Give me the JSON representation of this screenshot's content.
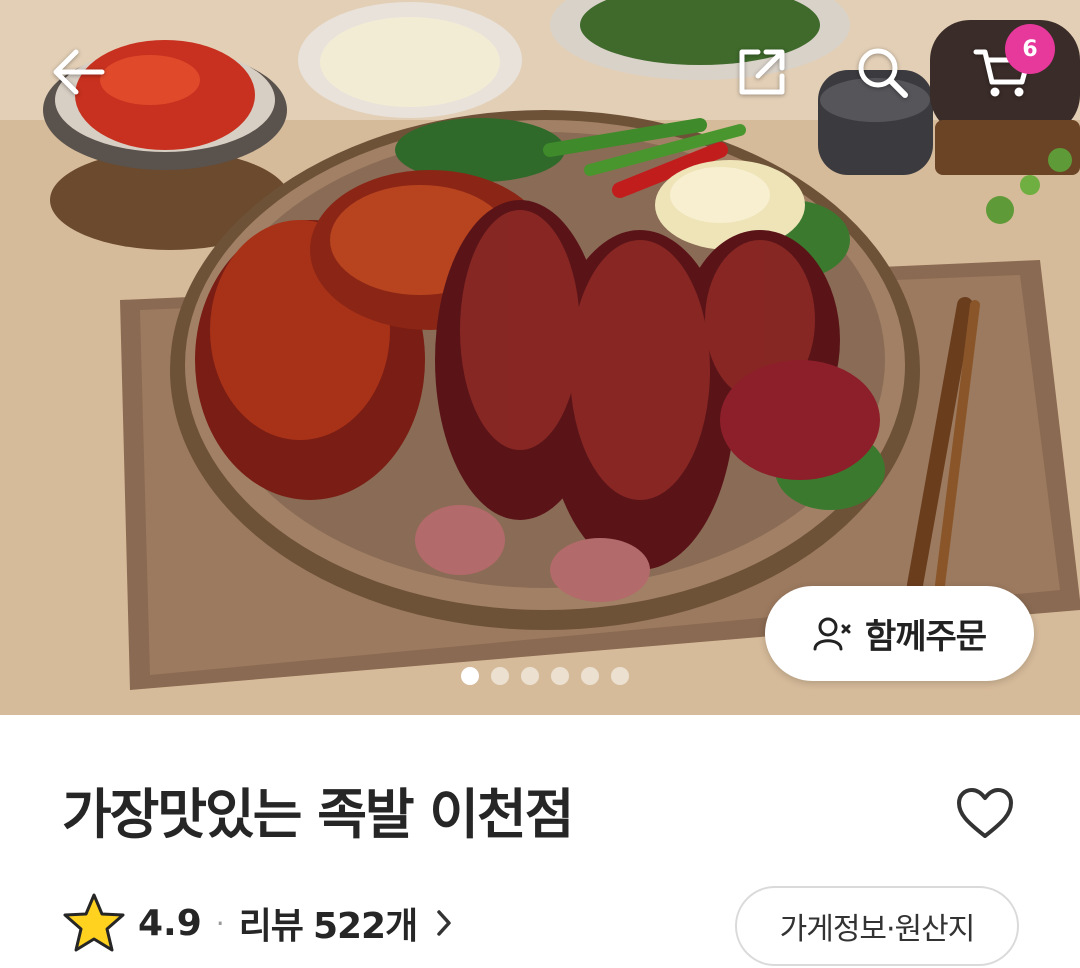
{
  "header": {
    "back_icon": "arrow-left-icon",
    "share_icon": "share-icon",
    "search_icon": "search-icon",
    "cart_icon": "cart-icon",
    "cart_count": "6"
  },
  "hero": {
    "group_order_label": "함께주문",
    "group_order_icon": "person-add-icon",
    "carousel_total": 6,
    "carousel_active": 1
  },
  "store": {
    "name": "가장맛있는 족발 이천점",
    "rating": "4.9",
    "review_label": "리뷰",
    "review_count": "522개",
    "info_button": "가게정보·원산지"
  },
  "colors": {
    "badge": "#e6399b",
    "star": "#ffd21f",
    "text": "#262626"
  }
}
